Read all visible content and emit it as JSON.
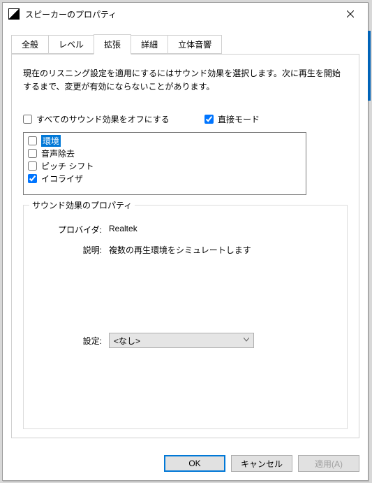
{
  "window": {
    "title": "スピーカーのプロパティ"
  },
  "tabs": {
    "general": "全般",
    "level": "レベル",
    "enhance": "拡張",
    "detail": "詳細",
    "spatial": "立体音響"
  },
  "page": {
    "description": "現在のリスニング設定を適用にするにはサウンド効果を選択します。次に再生を開始するまで、変更が有効にならないことがあります。",
    "disable_all": "すべてのサウンド効果をオフにする",
    "direct_mode": "直接モード"
  },
  "effects": [
    {
      "label": "環境",
      "checked": false,
      "selected": true
    },
    {
      "label": "音声除去",
      "checked": false,
      "selected": false
    },
    {
      "label": "ピッチ シフト",
      "checked": false,
      "selected": false
    },
    {
      "label": "イコライザ",
      "checked": true,
      "selected": false
    }
  ],
  "group": {
    "title": "サウンド効果のプロパティ",
    "provider_label": "プロバイダ:",
    "provider_value": "Realtek",
    "desc_label": "説明:",
    "desc_value": "複数の再生環境をシミュレートします",
    "setting_label": "設定:",
    "setting_value": "<なし>"
  },
  "buttons": {
    "ok": "OK",
    "cancel": "キャンセル",
    "apply": "適用(A)"
  }
}
